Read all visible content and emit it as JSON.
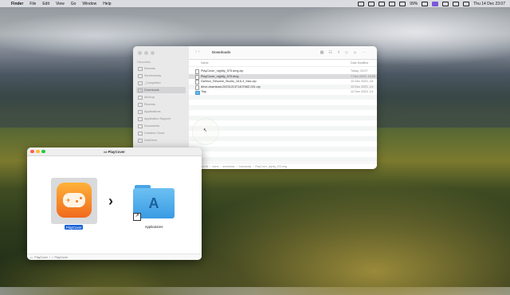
{
  "menubar": {
    "app_name": "Finder",
    "menus": [
      "File",
      "Edit",
      "View",
      "Go",
      "Window",
      "Help"
    ],
    "battery": "99%",
    "datetime": "Thu 14 Dec 23:07"
  },
  "finder": {
    "title": "Downloads",
    "sidebar_header": "Favourites",
    "sidebar_items": [
      "Recents",
      "Screenshots",
      "_Completed",
      "Downloads",
      "AirDrop",
      "Recents",
      "Applications",
      "Application Support",
      "Documents",
      "Creative Cloud",
      "OneDrive"
    ],
    "columns": {
      "name": "Name",
      "date": "Date Modified"
    },
    "files": [
      {
        "name": "PlayCover_nightly_575.dmg.zip",
        "date": "Today, 23:07"
      },
      {
        "name": "PlayCover_nightly_575.dmg",
        "date": "7 Dec 2023, 18:50"
      },
      {
        "name": "DaVinci_Resolve_Studio_18.6.4_Mac.zip",
        "date": "12 Dec 2023, 18:"
      },
      {
        "name": "drive-download-20231213T140758Z-001.zip",
        "date": "13 Dec 2023, 14:"
      },
      {
        "name": "Tidy",
        "date": "12 Dec 2023, 14:"
      }
    ],
    "path": [
      "Macintosh HD",
      "Users",
      "andrewtral",
      "Downloads",
      "PlayCover_nightly_575.dmg"
    ]
  },
  "dmg_window": {
    "title": "PlayCover",
    "app_label": "PlayCover",
    "folder_label": "Applications",
    "path": [
      "PlayCover",
      "PlayCover"
    ]
  },
  "colors": {
    "accent": "#1c63d6",
    "folder": "#4aa4e5",
    "app_icon": "#f58a2a"
  }
}
